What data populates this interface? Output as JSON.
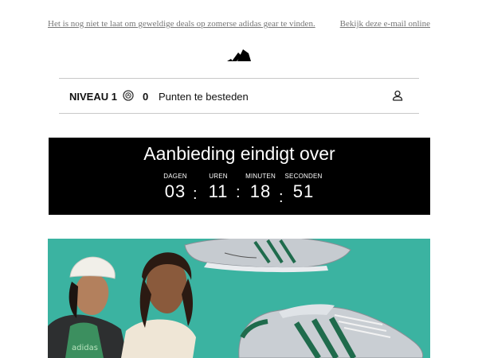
{
  "preheader": {
    "text": "Het is nog niet te laat om geweldige deals op zomerse adidas gear te vinden.",
    "view_online": "Bekijk deze e-mail online"
  },
  "brand": {
    "logo": "adidas-logo-icon"
  },
  "loyalty": {
    "level": "NIVEAU 1",
    "points": "0",
    "points_label": "Punten te besteden",
    "coin_icon": "points-coin-icon",
    "account_icon": "user-icon"
  },
  "countdown": {
    "title": "Aanbieding eindigt over",
    "units": [
      {
        "label": "DAGEN",
        "value": "03"
      },
      {
        "label": "UREN",
        "value": "11"
      },
      {
        "label": "MINUTEN",
        "value": "18"
      },
      {
        "label": "SECONDEN",
        "value": "51"
      }
    ],
    "separator": ":"
  },
  "hero": {
    "background": "#3bb3a1",
    "shirt_text": "adidas"
  },
  "colors": {
    "countdown_bg": "#000000",
    "preheader_text": "#777777",
    "hero_bg": "#3bb3a1",
    "shoe_stripes": "#1f6b4c"
  }
}
